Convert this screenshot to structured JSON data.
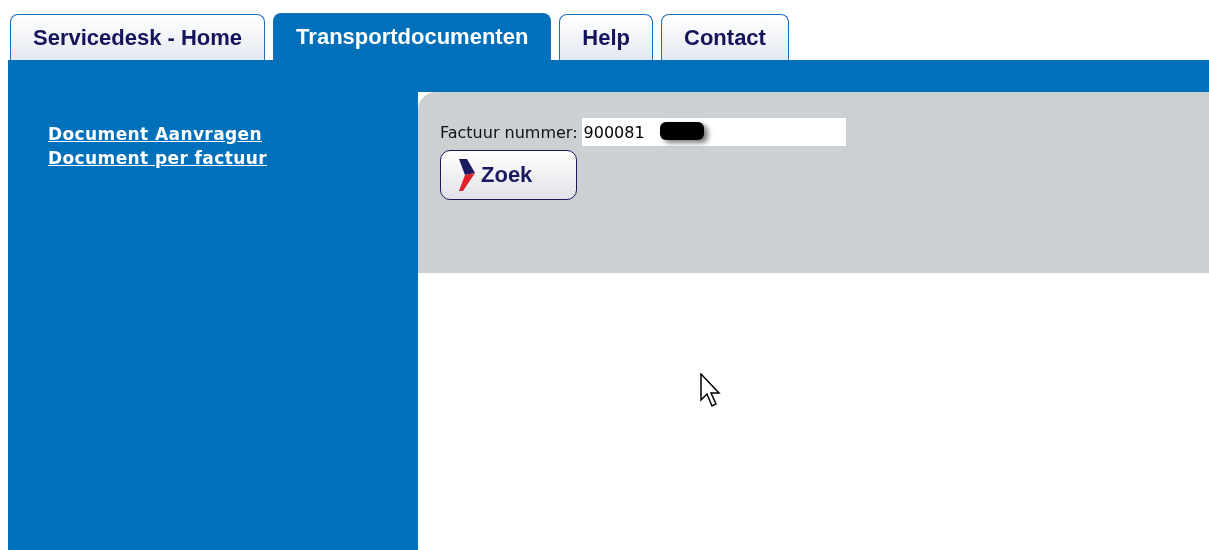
{
  "tabs": [
    {
      "label": "Servicedesk - Home",
      "selected": false
    },
    {
      "label": "Transportdocumenten",
      "selected": true
    },
    {
      "label": "Help",
      "selected": false
    },
    {
      "label": "Contact",
      "selected": false
    }
  ],
  "sidebar": {
    "links": [
      "Document Aanvragen",
      "Document per factuur"
    ]
  },
  "search": {
    "label": "Factuur nummer:",
    "value": "900081",
    "button": "Zoek"
  }
}
